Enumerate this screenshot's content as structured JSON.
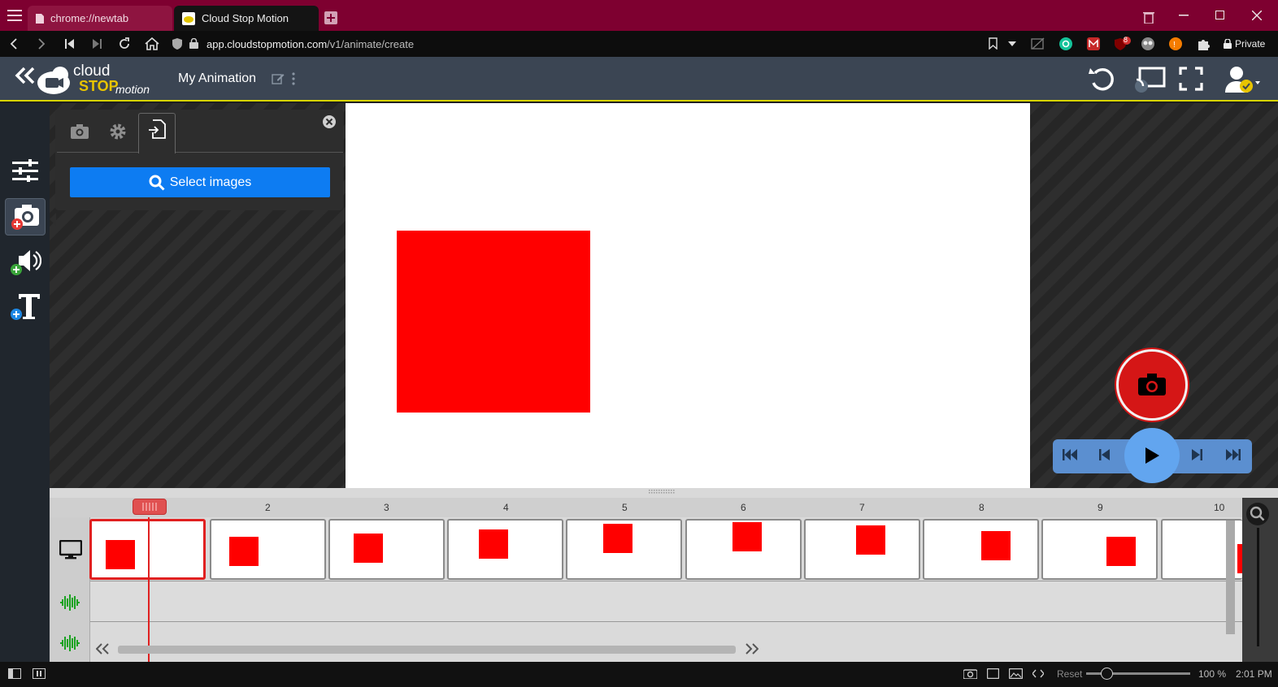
{
  "browser": {
    "tabs": [
      {
        "label": "chrome://newtab",
        "icon": "page-icon"
      },
      {
        "label": "Cloud Stop Motion",
        "icon": "cloudstopmotion-favicon"
      }
    ],
    "url_host": "app.cloudstopmotion.com",
    "url_path": "/v1/animate/create",
    "private_label": "Private",
    "extension_badge": "8"
  },
  "app": {
    "logo_top": "cloud",
    "logo_stop": "STOP",
    "logo_motion": "motion",
    "title": "My Animation"
  },
  "panel": {
    "tabs": [
      "camera-icon",
      "gear-icon",
      "import-icon"
    ],
    "active_tab": "import",
    "select_button": "Select images"
  },
  "timeline": {
    "frame_numbers": [
      "2",
      "3",
      "4",
      "5",
      "6",
      "7",
      "8",
      "9",
      "10"
    ],
    "selected_frame": 1
  },
  "status": {
    "reset": "Reset",
    "zoom": "100 %",
    "time": "2:01 PM"
  },
  "colors": {
    "tabbar": "#7e0030",
    "header": "#3b4553",
    "accent_line": "#d7d400",
    "shape": "#ff0000",
    "button_blue": "#0d7cf2",
    "capture_red": "#d51616"
  }
}
